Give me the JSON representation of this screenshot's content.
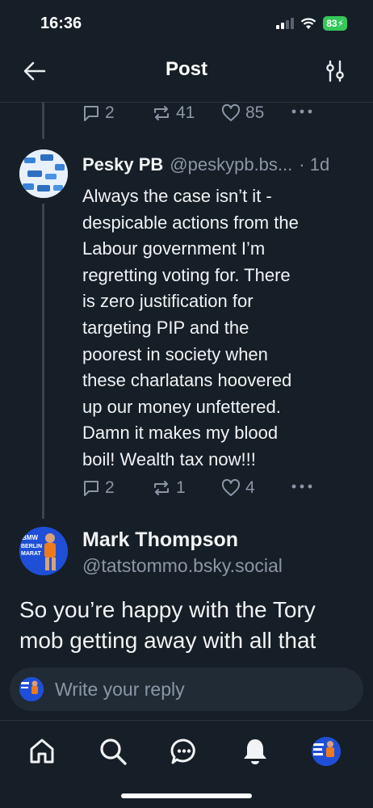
{
  "status_bar": {
    "time": "16:36",
    "battery": "83"
  },
  "header": {
    "title": "Post",
    "back_icon": "arrow-left-icon",
    "settings_icon": "sliders-icon"
  },
  "prev_post": {
    "replies": "2",
    "reposts": "41",
    "likes": "85"
  },
  "reply_post": {
    "author": "Pesky PB",
    "handle": "@peskypb.bs...",
    "time": "· 1d",
    "lines": [
      "Always the case isn’t it -",
      "despicable actions from the",
      "Labour government I’m",
      "regretting voting for. There",
      "is zero justification for",
      "targeting PIP and the",
      "poorest in society when",
      "these charlatans hoovered",
      "up our money unfettered.",
      "Damn it makes my blood",
      "boil! Wealth tax now!!!"
    ],
    "replies": "2",
    "reposts": "1",
    "likes": "4"
  },
  "focused_post": {
    "author": "Mark Thompson",
    "handle": "@tatstommo.bsky.social",
    "lines": [
      "So you’re happy with the Tory",
      "mob getting away with all that"
    ]
  },
  "composer": {
    "placeholder": "Write your reply"
  },
  "colors": {
    "background": "#161e27",
    "muted": "#8a97a6",
    "accent": "#1d4ed8"
  },
  "tab_bar": {
    "icons": [
      "home-icon",
      "search-icon",
      "chat-icon",
      "notifications-icon",
      "profile-avatar"
    ]
  }
}
